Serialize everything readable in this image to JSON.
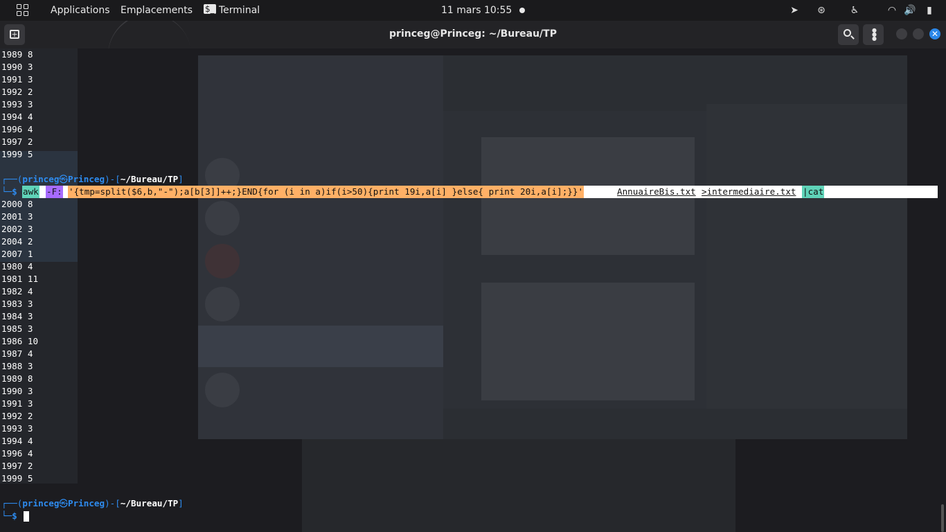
{
  "topbar": {
    "applications": "Applications",
    "places": "Emplacements",
    "terminal_app": "Terminal",
    "clock": "11 mars  10:55"
  },
  "window": {
    "title": "princeg@Princeg: ~/Bureau/TP"
  },
  "terminal": {
    "output_before": [
      "1989 8",
      "1990 3",
      "1991 3",
      "1992 2",
      "1993 3",
      "1994 4",
      "1996 4",
      "1997 2",
      "1999 5"
    ],
    "prompt_1": {
      "user": "princeg",
      "sep": "㉿",
      "host": "Princeg",
      "path": "~/Bureau/TP"
    },
    "command_segments": [
      "awk",
      "-F:",
      "'{tmp=split($6,b,\"-\");a[b[3]]++;}END{for (i in a)if(i>50){print 19i,a[i] }else{ print 20i,a[i];}}'",
      "AnnuaireBis.txt",
      ">intermediaire.txt",
      "|cat"
    ],
    "output_after": [
      "2000 8",
      "2001 3",
      "2002 3",
      "2004 2",
      "2007 1",
      "1980 4",
      "1981 11",
      "1982 4",
      "1983 3",
      "1984 3",
      "1985 3",
      "1986 10",
      "1987 4",
      "1988 3",
      "1989 8",
      "1990 3",
      "1991 3",
      "1992 2",
      "1993 3",
      "1994 4",
      "1996 4",
      "1997 2",
      "1999 5"
    ],
    "prompt_2": {
      "user": "princeg",
      "sep": "㉿",
      "host": "Princeg",
      "path": "~/Bureau/TP"
    }
  },
  "colors": {
    "prompt_blue": "#2e8cf0",
    "close_button": "#2b87e8",
    "seg_cmd": "#5fd3b8",
    "seg_flag": "#a66bff",
    "seg_string": "#ffb066",
    "seg_file": "#ffffff",
    "seg_redirect": "#2e8cf0"
  }
}
